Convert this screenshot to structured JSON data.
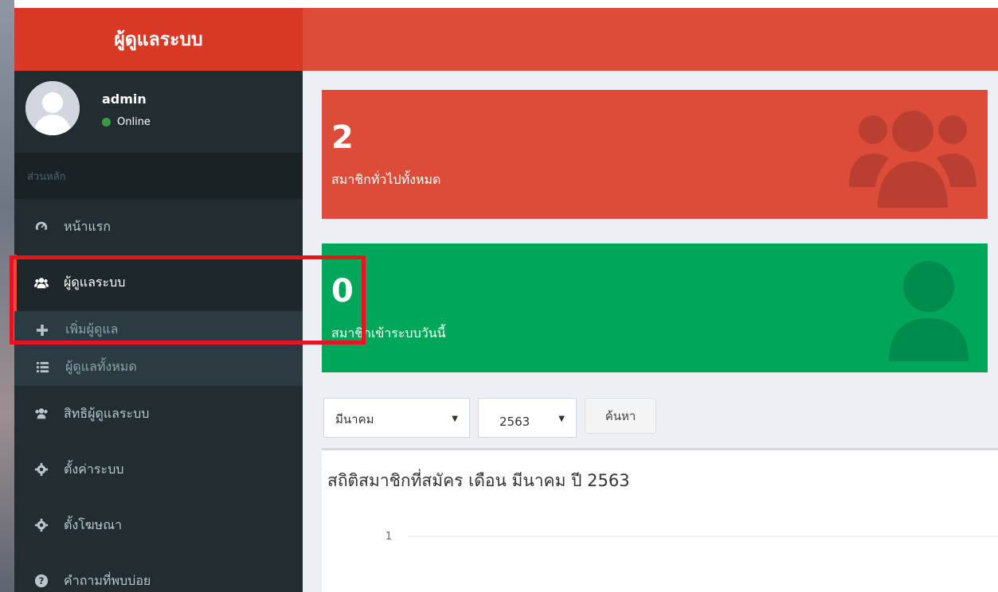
{
  "sidebar": {
    "logo": "ผู้ดูแลระบบ",
    "user": {
      "name": "admin",
      "status": "Online"
    },
    "section_header": "ส่วนหลัก",
    "items": {
      "home": "หน้าแรก",
      "admins": "ผู้ดูแลระบบ",
      "add_admin": "เพิ่มผู้ดูแล",
      "all_admins": "ผู้ดูแลทั้งหมด",
      "permissions": "สิทธิผู้ดูแลระบบ",
      "settings": "ตั้งค่าระบบ",
      "ads": "ตั้งโฆษณา",
      "faq": "คำถามที่พบบ่อย"
    }
  },
  "stats": {
    "members_total": {
      "value": "2",
      "label": "สมาชิกทั่วไปทั้งหมด"
    },
    "members_today": {
      "value": "0",
      "label": "สมาชิกเข้าระบบวันนี้"
    }
  },
  "filters": {
    "month": "มีนาคม",
    "year": "2563",
    "search_label": "ค้นหา"
  },
  "chart": {
    "title": "สถิติสมาชิกที่สมัคร เดือน มีนาคม ปี 2563",
    "y_tick": "1"
  },
  "colors": {
    "accent_red": "#dd4b39",
    "accent_green": "#00a65a",
    "sidebar_bg": "#222d32",
    "highlight": "#e8131b"
  }
}
